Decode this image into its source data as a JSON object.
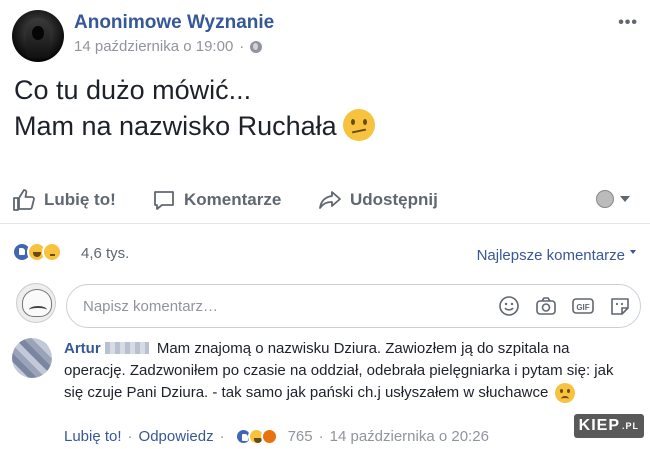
{
  "post": {
    "page_name": "Anonimowe Wyznanie",
    "timestamp": "14 października o 19:00",
    "text_line1": "Co tu dużo mówić...",
    "text_line2": "Mam na nazwisko Ruchała",
    "emoji": "confused-face-emoji"
  },
  "actions": {
    "like": "Lubię to!",
    "comment": "Komentarze",
    "share": "Udostępnij"
  },
  "reactions": {
    "icons": [
      "like",
      "haha",
      "sad"
    ],
    "count": "4,6 tys.",
    "sort_label": "Najlepsze komentarze"
  },
  "composer": {
    "placeholder": "Napisz komentarz…",
    "tools": [
      "emoji-icon",
      "camera-icon",
      "gif-icon",
      "sticker-icon"
    ]
  },
  "comment": {
    "author": "Artur",
    "text": "Mam znajomą o nazwisku Dziura. Zawiozłem ją do szpitala na operację. Zadzwoniłem po czasie na oddział, odebrała pielęgniarka i pytam się: jak się czuje Pani Dziura. - tak samo jak pański ch.j usłyszałem w słuchawce",
    "like_label": "Lubię to!",
    "separator": "·",
    "reply_label": "Odpowiedz",
    "reaction_icons": [
      "like",
      "haha",
      "angry"
    ],
    "reaction_count": "765",
    "date": "14 października o 20:26"
  },
  "watermark": {
    "main": "KIEP",
    "suffix": ".PL"
  },
  "colors": {
    "link": "#365899",
    "meta": "#90949c",
    "action": "#606770",
    "like_blue": "#4267b2",
    "emoji_yellow": "#f7c33f"
  }
}
